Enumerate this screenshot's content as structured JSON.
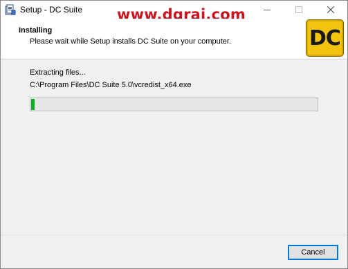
{
  "window": {
    "title": "Setup - DC Suite",
    "watermark": "www.dgrai.com"
  },
  "titlebar_buttons": {
    "minimize_icon": "minimize-icon",
    "maximize_icon": "maximize-icon",
    "close_icon": "close-icon"
  },
  "header": {
    "title": "Installing",
    "subtitle": "Please wait while Setup installs DC Suite on your computer.",
    "logo_text": "DC"
  },
  "main": {
    "status": "Extracting files...",
    "current_file": "C:\\Program Files\\DC Suite 5.0\\vcredist_x64.exe",
    "progress": 0.012
  },
  "footer": {
    "cancel_label": "Cancel"
  },
  "colors": {
    "progress_fill": "#06b025",
    "watermark": "#c8141e",
    "logo_bg": "#f2c410",
    "button_focus_border": "#0078d7"
  }
}
